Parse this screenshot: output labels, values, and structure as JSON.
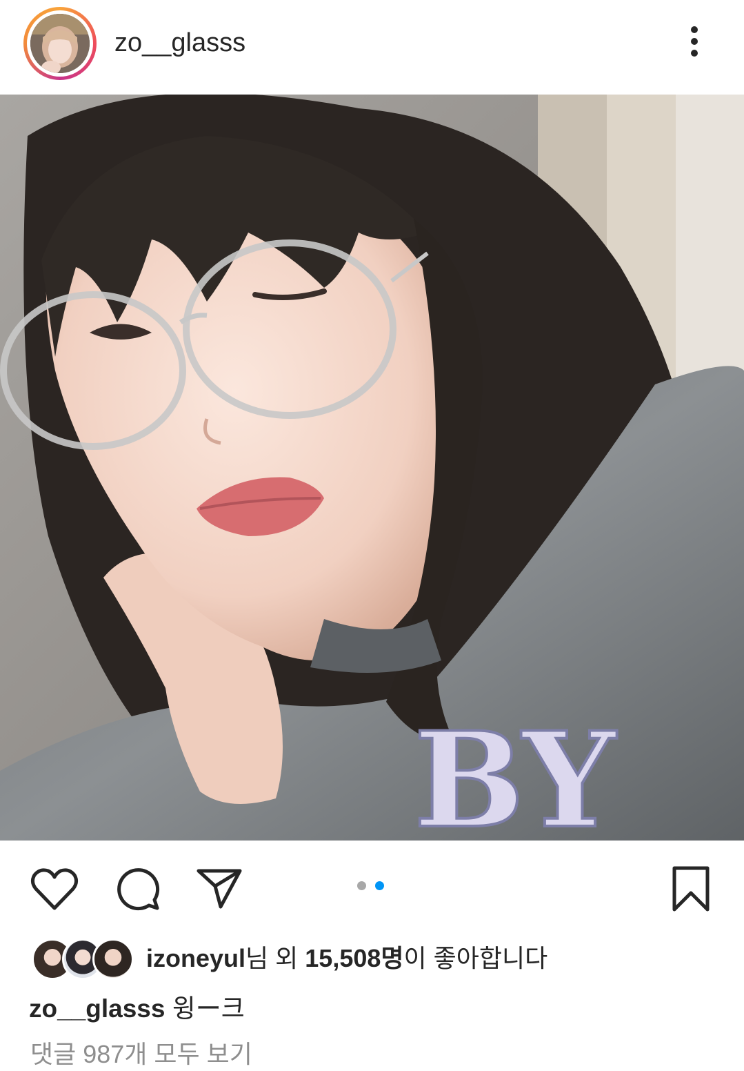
{
  "post": {
    "username": "zo__glasss",
    "caption_text": "윙ー크"
  },
  "header": {
    "avatar_icon": "profile-avatar",
    "more_icon": "more-vertical-icon"
  },
  "photo": {
    "description_icon": "selfie-photo",
    "shirt_letters": "BY"
  },
  "actions": {
    "like_icon": "heart-icon",
    "comment_icon": "comment-icon",
    "share_icon": "paper-plane-icon",
    "save_icon": "bookmark-icon",
    "carousel": {
      "count": 2,
      "active_index": 1
    }
  },
  "likes": {
    "liker": "izoneyul",
    "suffix1": "님 외 ",
    "count": "15,508명",
    "suffix2": "이 좋아합니다"
  },
  "comments_link": "댓글 987개 모두 보기",
  "colors": {
    "text": "#262626",
    "muted": "#8e8e8e",
    "dot_active": "#0095f6",
    "dot_inactive": "#a8a8a8"
  }
}
